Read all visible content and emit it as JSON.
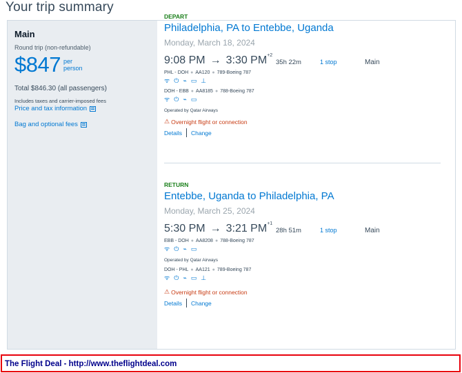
{
  "page": {
    "title": "Your trip summary"
  },
  "fare": {
    "cabin": "Main",
    "trip_type": "Round trip (non-refundable)",
    "price": "$847",
    "per": "per",
    "person": "person",
    "total": "Total $846.30 (all passengers)",
    "includes": "Includes taxes and carrier-imposed fees",
    "price_info_link": "Price and tax information",
    "bag_fees_link": "Bag and optional fees"
  },
  "depart": {
    "label": "DEPART",
    "route": "Philadelphia, PA to Entebbe, Uganda",
    "date": "Monday, March 18, 2024",
    "dep_time": "9:08 PM",
    "arrow": "→",
    "arr_time": "3:30 PM",
    "day_offset": "+2",
    "duration": "35h 22m",
    "stops": "1 stop",
    "class": "Main",
    "leg1": {
      "route": "PHL - DOH",
      "flight": "AA120",
      "aircraft": "789-Boeing 787"
    },
    "leg2": {
      "route": "DOH - EBB",
      "flight": "AA8185",
      "aircraft": "788-Boeing 787"
    },
    "operated": "Operated by Qatar Airways",
    "overnight": "Overnight flight or connection",
    "details": "Details",
    "change": "Change"
  },
  "return": {
    "label": "RETURN",
    "route": "Entebbe, Uganda to Philadelphia, PA",
    "date": "Monday, March 25, 2024",
    "dep_time": "5:30 PM",
    "arrow": "→",
    "arr_time": "3:21 PM",
    "day_offset": "+1",
    "duration": "28h 51m",
    "stops": "1 stop",
    "class": "Main",
    "leg1": {
      "route": "EBB - DOH",
      "flight": "AA8208",
      "aircraft": "788-Boeing 787"
    },
    "operated": "Operated by Qatar Airways",
    "leg2": {
      "route": "DOH - PHL",
      "flight": "AA121",
      "aircraft": "789-Boeing 787"
    },
    "overnight": "Overnight flight or connection",
    "details": "Details",
    "change": "Change"
  },
  "footer": {
    "text": "The Flight Deal - http://www.theflightdeal.com"
  },
  "colors": {
    "link": "#0078d2",
    "green": "#1a7f1a",
    "warning": "#c83c14",
    "footer_border": "#e8000b",
    "footer_text": "#00008b"
  }
}
